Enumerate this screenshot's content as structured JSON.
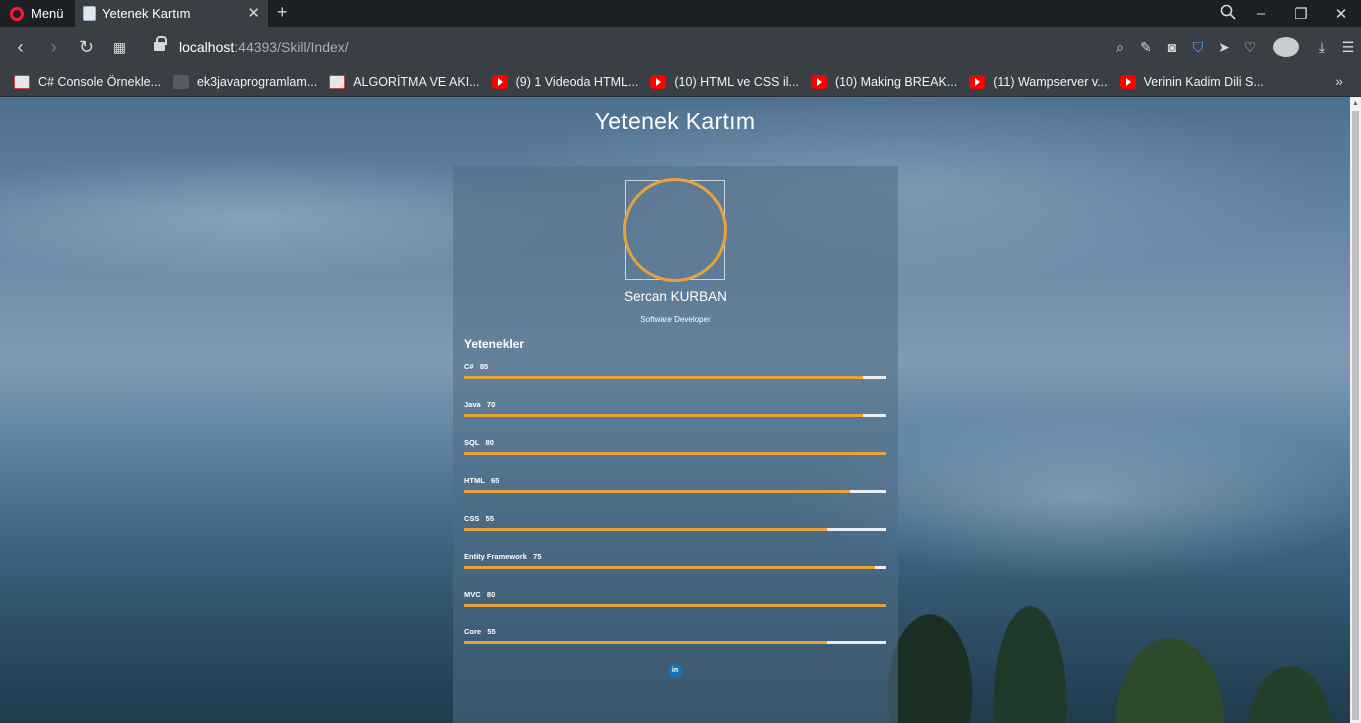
{
  "browser": {
    "menu_label": "Menü",
    "tab_title": "Yetenek Kartım",
    "url_host": "localhost",
    "url_rest": ":44393/Skill/Index/"
  },
  "bookmarks": [
    {
      "label": "C# Console Örnekle...",
      "icon": "site"
    },
    {
      "label": "ek3javaprogramlam...",
      "icon": "dark"
    },
    {
      "label": "ALGORİTMA VE AKI...",
      "icon": "site"
    },
    {
      "label": "(9) 1 Videoda HTML...",
      "icon": "yt"
    },
    {
      "label": "(10) HTML ve CSS il...",
      "icon": "yt"
    },
    {
      "label": "(10) Making BREAK...",
      "icon": "yt"
    },
    {
      "label": "(11) Wampserver v...",
      "icon": "yt"
    },
    {
      "label": "Verinin Kadim Dili S...",
      "icon": "yt"
    }
  ],
  "page": {
    "title": "Yetenek Kartım",
    "name": "Sercan KURBAN",
    "role": "Software Developer",
    "skills_title": "Yetenekler",
    "accent_color": "#e8a23c",
    "skills": [
      {
        "label": "C#   85",
        "fill": 0.945
      },
      {
        "label": "Java   70",
        "fill": 0.945
      },
      {
        "label": "SQL   80",
        "fill": 1.0
      },
      {
        "label": "HTML   65",
        "fill": 0.915
      },
      {
        "label": "CSS   55",
        "fill": 0.86
      },
      {
        "label": "Entity Framework   75",
        "fill": 0.975
      },
      {
        "label": "MVC   80",
        "fill": 1.0
      },
      {
        "label": "Core   55",
        "fill": 0.86
      }
    ],
    "linkedin_label": "in"
  }
}
